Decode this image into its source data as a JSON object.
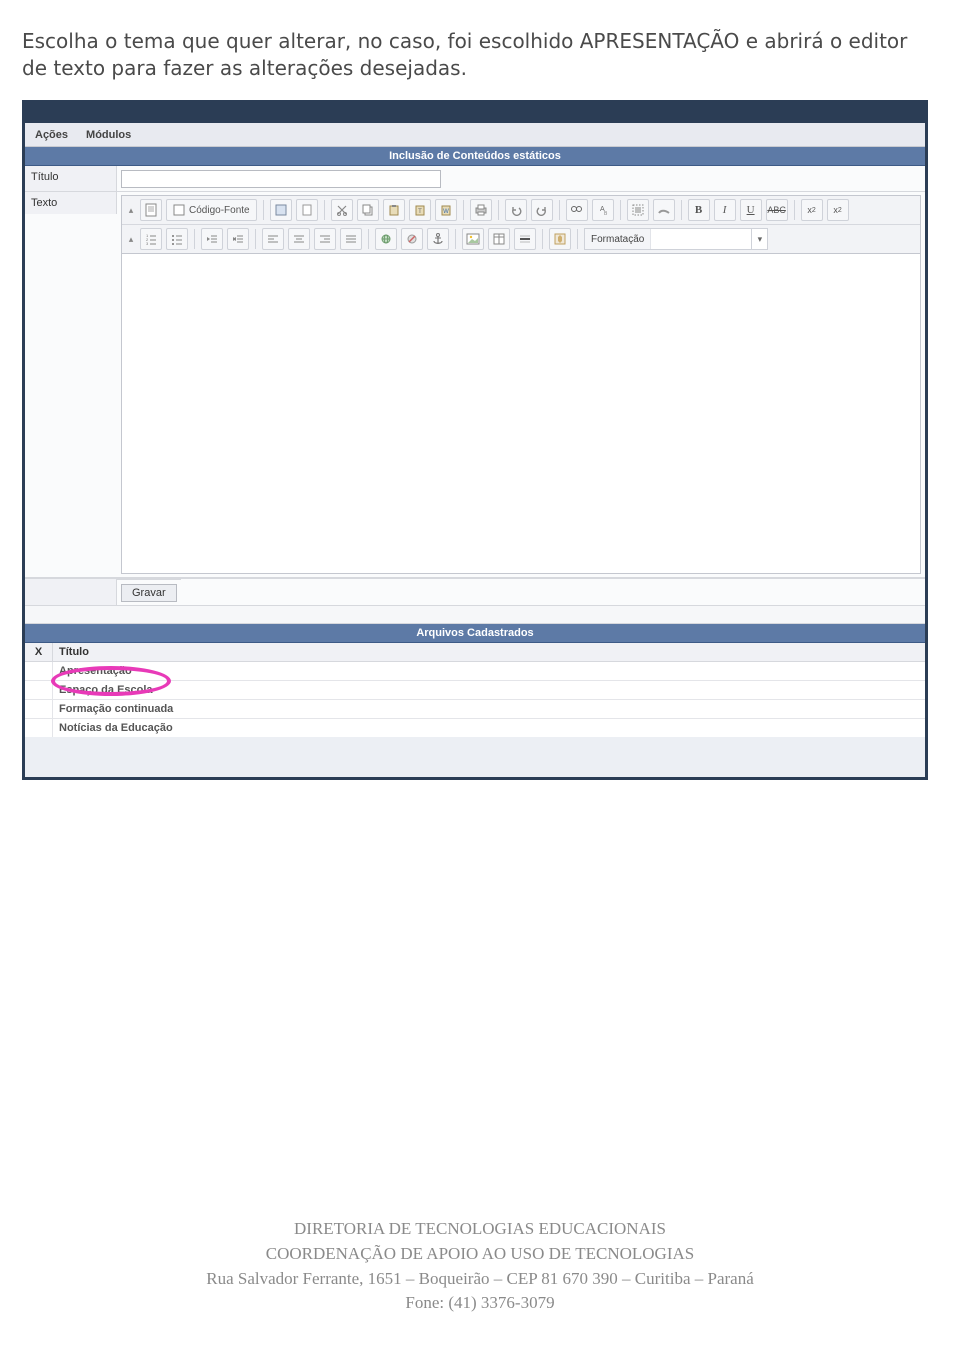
{
  "intro": "Escolha o tema que quer alterar, no caso, foi escolhido APRESENTAÇÃO e abrirá o editor de texto para fazer as alterações desejadas.",
  "menubar": {
    "item1": "Ações",
    "item2": "Módulos"
  },
  "panel1_title": "Inclusão de Conteúdos estáticos",
  "form": {
    "titulo_label": "Título",
    "texto_label": "Texto",
    "titulo_value": ""
  },
  "toolbar": {
    "source_label": "Código-Fonte",
    "format_label": "Formatação",
    "format_value": ""
  },
  "gravar_label": "Gravar",
  "panel2_title": "Arquivos Cadastrados",
  "list": {
    "col_x": "X",
    "col_titulo": "Título",
    "rows": [
      {
        "titulo": "Apresentação"
      },
      {
        "titulo": "Espaço da Escola"
      },
      {
        "titulo": "Formação continuada"
      },
      {
        "titulo": "Notícias da Educação"
      }
    ]
  },
  "footer": {
    "l1": "DIRETORIA DE TECNOLOGIAS EDUCACIONAIS",
    "l2": "COORDENAÇÃO DE APOIO AO USO DE TECNOLOGIAS",
    "l3": "Rua Salvador Ferrante, 1651 – Boqueirão – CEP 81 670 390 – Curitiba – Paraná",
    "l4": "Fone: (41) 3376-3079"
  }
}
